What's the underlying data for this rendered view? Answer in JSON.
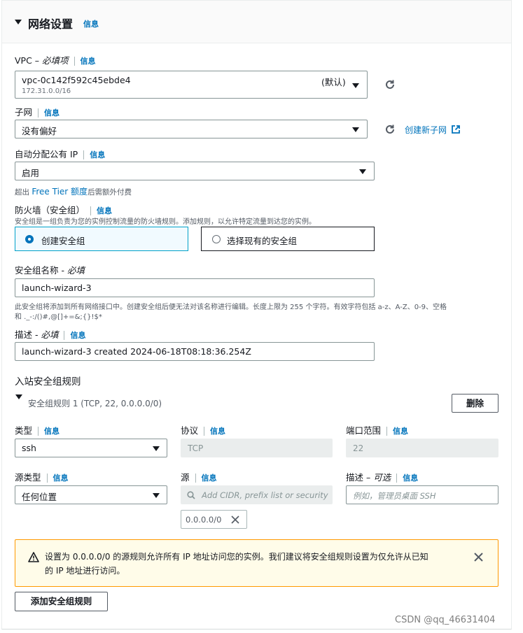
{
  "section": {
    "title": "网络设置",
    "info": "信息"
  },
  "vpc": {
    "label": "VPC –",
    "required": "必填项",
    "info": "信息",
    "value": "vpc-0c142f592c45ebde4",
    "cidr": "172.31.0.0/16",
    "default_tag": "(默认)"
  },
  "subnet": {
    "label": "子网",
    "info": "信息",
    "value": "没有偏好",
    "create_link": "创建新子网"
  },
  "public_ip": {
    "label": "自动分配公有 IP",
    "info": "信息",
    "value": "启用",
    "note_prefix": "超出",
    "note_link": "Free Tier 额度",
    "note_suffix": "后需额外付费"
  },
  "firewall": {
    "label": "防火墙（安全组）",
    "info": "信息",
    "description": "安全组是一组负责为您的实例控制流量的防火墙规则。添加规则，以允许特定流量到达您的实例。",
    "option_create": "创建安全组",
    "option_existing": "选择现有的安全组"
  },
  "sg_name": {
    "label": "安全组名称 -",
    "required": "必填",
    "value": "launch-wizard-3",
    "hint_line1": "此安全组将添加到所有网络接口中。创建安全组后便无法对该名称进行编辑。长度上限为 255 个字符。有效字符包括 a-z、A-Z、0-9、空格",
    "hint_line2": "和 ._-:/()#,@[]+=&;{}!$*"
  },
  "description": {
    "label": "描述 -",
    "required": "必填",
    "info": "信息",
    "value": "launch-wizard-3 created 2024-06-18T08:18:36.254Z"
  },
  "inbound": {
    "title": "入站安全组规则",
    "rule_title": "安全组规则 1 (TCP, 22, 0.0.0.0/0)",
    "delete_button": "删除",
    "type_label": "类型",
    "type_info": "信息",
    "type_value": "ssh",
    "protocol_label": "协议",
    "protocol_info": "信息",
    "protocol_value": "TCP",
    "port_label": "端口范围",
    "port_info": "信息",
    "port_value": "22",
    "source_type_label": "源类型",
    "source_type_info": "信息",
    "source_type_value": "任何位置",
    "source_label": "源",
    "source_info": "信息",
    "source_placeholder": "Add CIDR, prefix list or security",
    "source_token": "0.0.0.0/0",
    "desc_label": "描述 –",
    "desc_optional": "可选",
    "desc_info": "信息",
    "desc_placeholder": "例如，管理员桌面 SSH"
  },
  "warning": {
    "line1": "设置为 0.0.0.0/0 的源规则允许所有 IP 地址访问您的实例。我们建议将安全组规则设置为仅允许从已知",
    "line2": "的 IP 地址进行访问。"
  },
  "add_rule_button": "添加安全组规则",
  "watermark": "CSDN @qq_46631404",
  "colors": {
    "link": "#0073bb",
    "selected_border": "#00a1c9",
    "warning_border": "#ff9900",
    "warning_bg": "#fffce9"
  }
}
